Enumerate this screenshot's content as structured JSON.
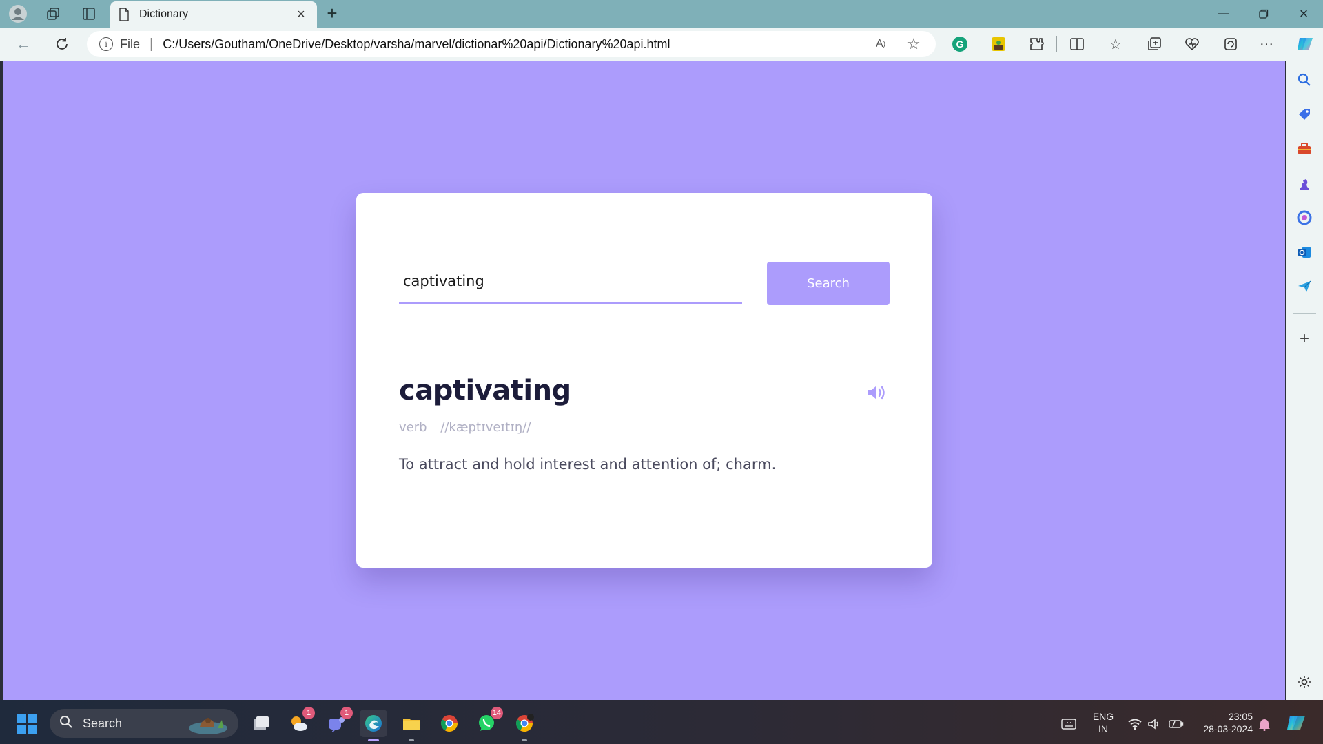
{
  "browser": {
    "tab": {
      "title": "Dictionary"
    },
    "address": {
      "scheme_label": "File",
      "url": "C:/Users/Goutham/OneDrive/Desktop/varsha/marvel/dictionar%20api/Dictionary%20api.html"
    }
  },
  "page": {
    "search": {
      "value": "captivating",
      "button_label": "Search"
    },
    "result": {
      "word": "captivating",
      "part_of_speech": "verb",
      "phonetic": "//kæptɪveɪtɪŋ//",
      "definition": "To attract and hold interest and attention of; charm."
    },
    "colors": {
      "background": "#ac9cfc",
      "card": "#ffffff",
      "accent": "#ac9cfc",
      "word": "#1c1c3a"
    }
  },
  "taskbar": {
    "search_label": "Search",
    "badges": {
      "weather": "1",
      "teams": "1",
      "whatsapp": "14"
    },
    "language": {
      "line1": "ENG",
      "line2": "IN"
    },
    "clock": {
      "time": "23:05",
      "date": "28-03-2024"
    }
  },
  "icons": {
    "sidebar": [
      "search-icon",
      "tag-icon",
      "toolbox-icon",
      "chess-icon",
      "copilot-icon",
      "outlook-icon",
      "send-icon",
      "add-icon",
      "settings-icon"
    ]
  }
}
